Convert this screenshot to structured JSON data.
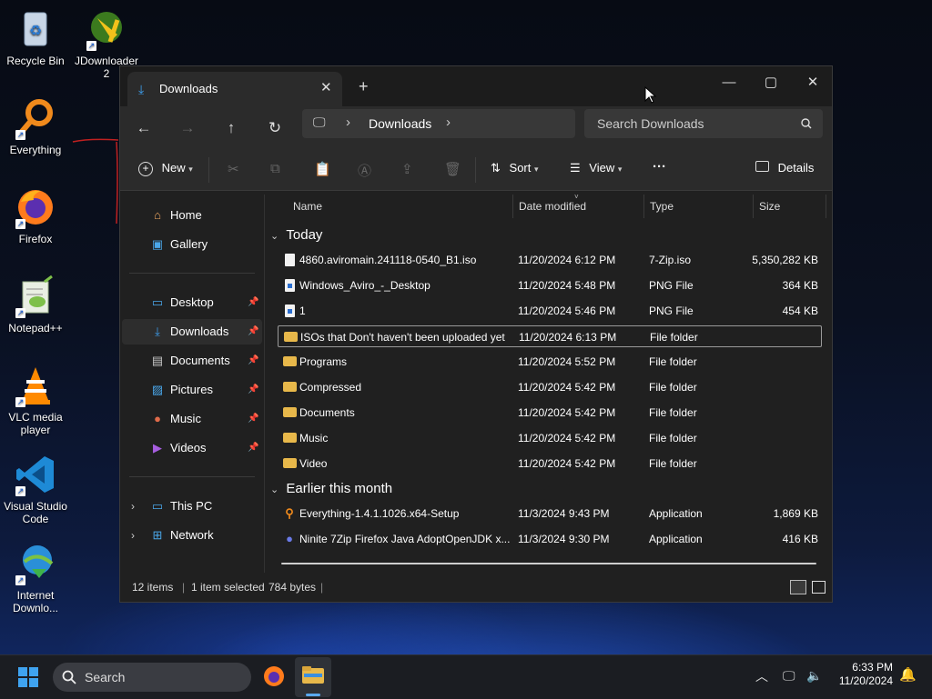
{
  "desktop": {
    "icons": [
      {
        "label": "Recycle Bin"
      },
      {
        "label": "JDownloader 2"
      },
      {
        "label": "Everything"
      },
      {
        "label": "Firefox"
      },
      {
        "label": "Notepad++"
      },
      {
        "label": "VLC media player"
      },
      {
        "label": "Visual Studio Code"
      },
      {
        "label": "Internet Downlo..."
      }
    ]
  },
  "window": {
    "tab_title": "Downloads",
    "new_tab": "+",
    "controls": {
      "minimize": "—",
      "maximize": "▢",
      "close": "✕"
    },
    "nav": {
      "back": "←",
      "forward": "→",
      "up": "↑",
      "refresh": "↻",
      "breadcrumb_current": "Downloads",
      "breadcrumb_sep": "›",
      "search_placeholder": "Search Downloads"
    },
    "toolbar": {
      "new": "New",
      "sort": "Sort",
      "view": "View",
      "more": "···",
      "details": "Details"
    },
    "sidebar": {
      "items": [
        {
          "label": "Home",
          "icon": "home-icon"
        },
        {
          "label": "Gallery",
          "icon": "gallery-icon"
        },
        {
          "label": "Desktop",
          "icon": "desktop-icon",
          "pinned": true
        },
        {
          "label": "Downloads",
          "icon": "download-icon",
          "pinned": true,
          "selected": true
        },
        {
          "label": "Documents",
          "icon": "documents-icon",
          "pinned": true
        },
        {
          "label": "Pictures",
          "icon": "pictures-icon",
          "pinned": true
        },
        {
          "label": "Music",
          "icon": "music-icon",
          "pinned": true
        },
        {
          "label": "Videos",
          "icon": "videos-icon",
          "pinned": true
        },
        {
          "label": "This PC",
          "icon": "pc-icon"
        },
        {
          "label": "Network",
          "icon": "network-icon"
        }
      ]
    },
    "columns": {
      "name": "Name",
      "date": "Date modified",
      "type": "Type",
      "size": "Size"
    },
    "groups": [
      {
        "label": "Today",
        "rows": [
          {
            "name": "4860.aviromain.241118-0540_B1.iso",
            "date": "11/20/2024 6:12 PM",
            "type": "7-Zip.iso",
            "size": "5,350,282 KB",
            "icon": "file-icon"
          },
          {
            "name": "Windows_Aviro_-_Desktop",
            "date": "11/20/2024 5:48 PM",
            "type": "PNG File",
            "size": "364 KB",
            "icon": "png-icon"
          },
          {
            "name": "1",
            "date": "11/20/2024 5:46 PM",
            "type": "PNG File",
            "size": "454 KB",
            "icon": "png-icon"
          },
          {
            "name": "ISOs that Don't haven't been uploaded yet",
            "date": "11/20/2024 6:13 PM",
            "type": "File folder",
            "size": "",
            "icon": "folder-icon",
            "selected": true
          },
          {
            "name": "Programs",
            "date": "11/20/2024 5:52 PM",
            "type": "File folder",
            "size": "",
            "icon": "folder-icon"
          },
          {
            "name": "Compressed",
            "date": "11/20/2024 5:42 PM",
            "type": "File folder",
            "size": "",
            "icon": "folder-icon"
          },
          {
            "name": "Documents",
            "date": "11/20/2024 5:42 PM",
            "type": "File folder",
            "size": "",
            "icon": "folder-icon"
          },
          {
            "name": "Music",
            "date": "11/20/2024 5:42 PM",
            "type": "File folder",
            "size": "",
            "icon": "folder-icon"
          },
          {
            "name": "Video",
            "date": "11/20/2024 5:42 PM",
            "type": "File folder",
            "size": "",
            "icon": "folder-icon"
          }
        ]
      },
      {
        "label": "Earlier this month",
        "rows": [
          {
            "name": "Everything-1.4.1.1026.x64-Setup",
            "date": "11/3/2024 9:43 PM",
            "type": "Application",
            "size": "1,869 KB",
            "icon": "everything-app-icon"
          },
          {
            "name": "Ninite 7Zip Firefox Java AdoptOpenJDK x...",
            "date": "11/3/2024 9:30 PM",
            "type": "Application",
            "size": "416 KB",
            "icon": "ninite-app-icon"
          }
        ]
      }
    ],
    "status": {
      "items": "12 items",
      "selected": "1 item selected",
      "bytes": "784 bytes"
    }
  },
  "taskbar": {
    "search_label": "Search",
    "clock_time": "6:33 PM",
    "clock_date": "11/20/2024"
  },
  "colors": {
    "accent": "#3ea0f0",
    "folder": "#e8b84a",
    "window_bg": "#202020"
  }
}
